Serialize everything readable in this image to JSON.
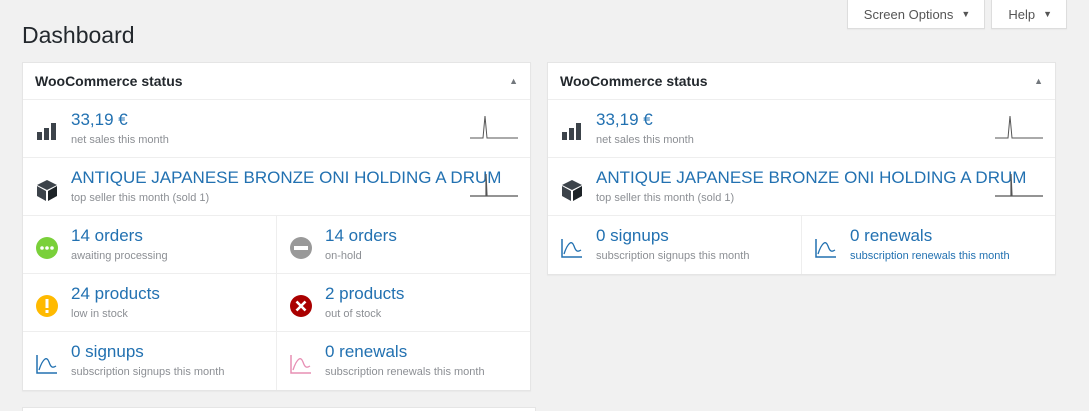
{
  "screen_meta": {
    "screen_options": "Screen Options",
    "help": "Help"
  },
  "page": {
    "title": "Dashboard"
  },
  "widget_left": {
    "title": "WooCommerce status",
    "net_sales": {
      "value": "33,19 €",
      "label": "net sales this month"
    },
    "top_seller": {
      "value": "ANTIQUE JAPANESE BRONZE ONI HOLDING A DRUM",
      "label": "top seller this month (sold 1)"
    },
    "processing": {
      "value": "14 orders",
      "label": "awaiting processing"
    },
    "on_hold": {
      "value": "14 orders",
      "label": "on-hold"
    },
    "low_stock": {
      "value": "24 products",
      "label": "low in stock"
    },
    "out_of_stock": {
      "value": "2 products",
      "label": "out of stock"
    },
    "signups": {
      "value": "0 signups",
      "label": "subscription signups this month"
    },
    "renewals": {
      "value": "0 renewals",
      "label": "subscription renewals this month"
    }
  },
  "widget_right": {
    "title": "WooCommerce status",
    "net_sales": {
      "value": "33,19 €",
      "label": "net sales this month"
    },
    "top_seller": {
      "value": "ANTIQUE JAPANESE BRONZE ONI HOLDING A DRUM",
      "label": "top seller this month (sold 1)"
    },
    "signups": {
      "value": "0 signups",
      "label": "subscription signups this month"
    },
    "renewals": {
      "value": "0 renewals",
      "label": "subscription renewals this month"
    }
  },
  "icons": {
    "sales": "bar-chart-icon",
    "top_seller": "box-icon",
    "processing": "dots-circle-icon",
    "on_hold": "minus-circle-icon",
    "low_stock": "exclamation-circle-icon",
    "out_of_stock": "x-circle-icon",
    "signups": "signup-chart-icon",
    "renewals": "renewal-chart-icon"
  },
  "colors": {
    "link": "#2271b1",
    "processing": "#7ad03a",
    "on_hold": "#999999",
    "low_stock": "#ffba00",
    "out_of_stock": "#a00000",
    "signups_icon": "#2271b1",
    "renewals_icon": "#e78fb4"
  }
}
